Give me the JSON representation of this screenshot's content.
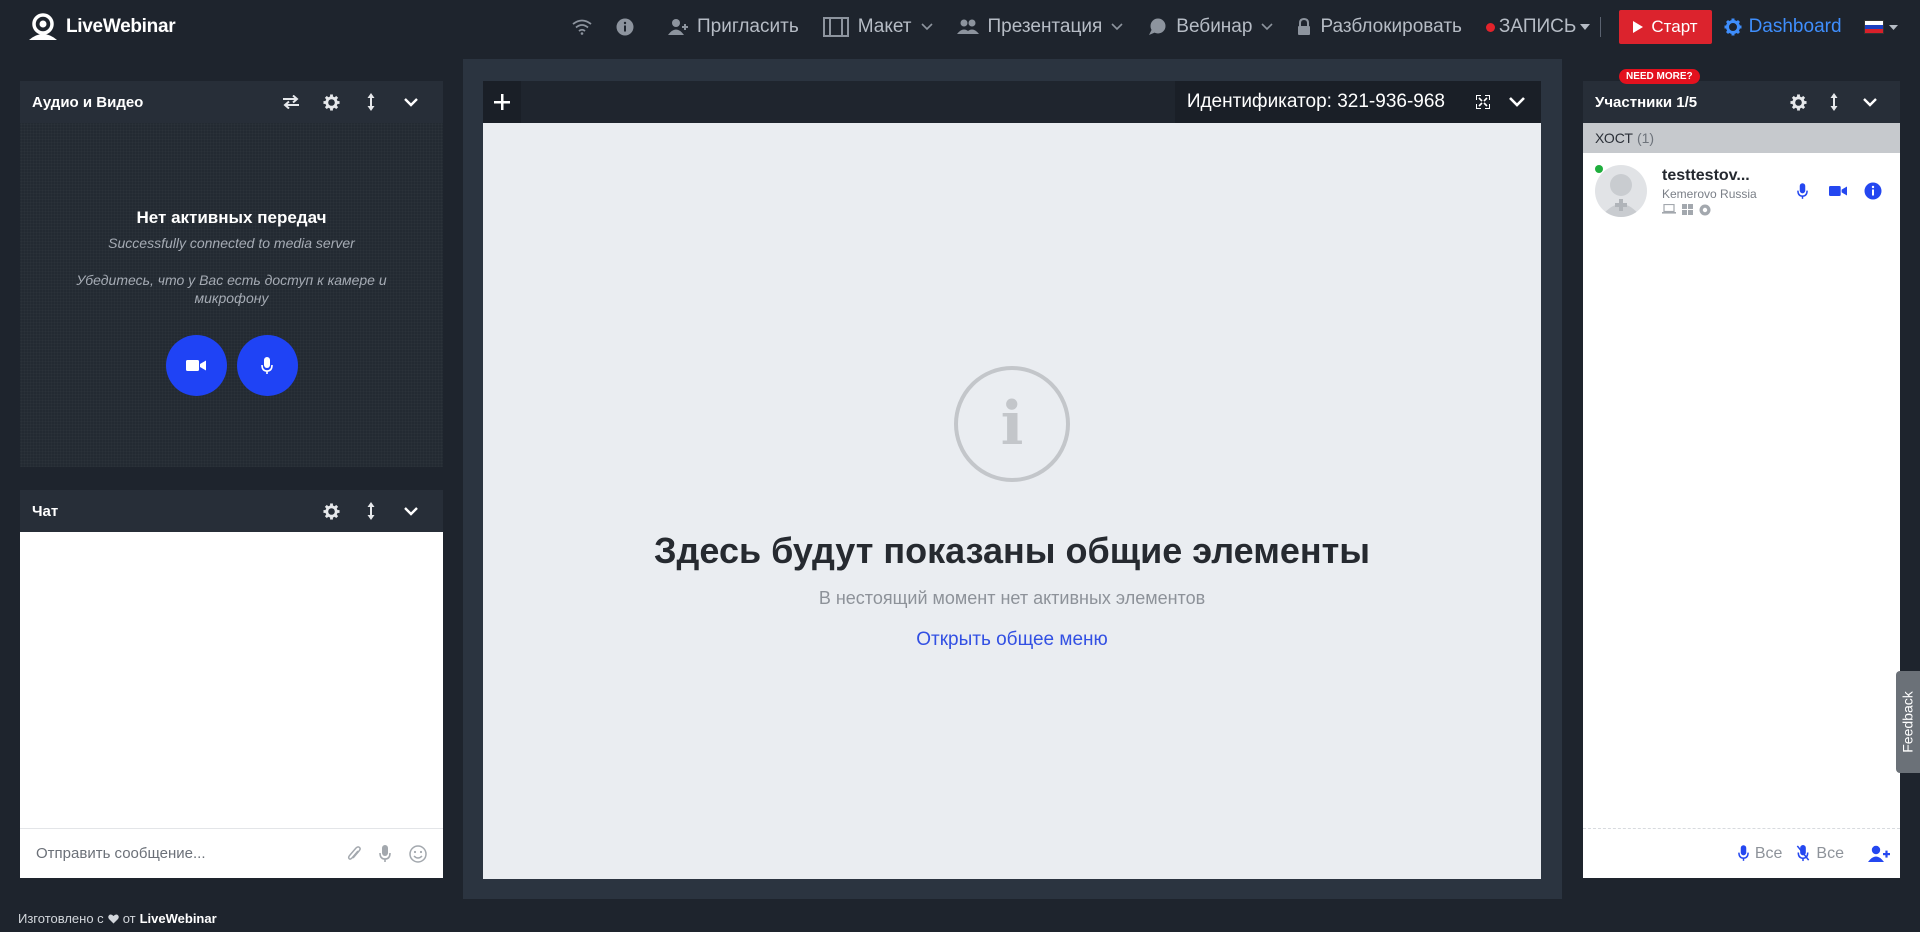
{
  "app": {
    "logo_text": "LiveWebinar"
  },
  "nav": {
    "invite": "Пригласить",
    "layout": "Макет",
    "presentation": "Презентация",
    "webinar": "Вебинар",
    "unlock": "Разблокировать",
    "record": "ЗАПИСЬ",
    "start": "Старт",
    "dashboard": "Dashboard"
  },
  "av_panel": {
    "title": "Аудио и Видео",
    "no_streams": "Нет активных передач",
    "connected": "Successfully connected to media server",
    "hint": "Убедитесь, что у Вас есть доступ к камере и микрофону"
  },
  "chat_panel": {
    "title": "Чат",
    "input_placeholder": "Отправить сообщение..."
  },
  "center": {
    "identifier": "Идентификатор: 321-936-968",
    "empty_title": "Здесь будут показаны общие элементы",
    "empty_sub": "В нестоящий момент нет активных элементов",
    "open_menu_link": "Открыть общее меню"
  },
  "participants": {
    "title": "Участники 1/5",
    "need_more": "NEED MORE?",
    "host_label": "ХОСТ",
    "host_count": "(1)",
    "users": [
      {
        "name": "testtestov...",
        "location": "Kemerovo Russia"
      }
    ],
    "footer_mic_all": "Все",
    "footer_mute_all": "Все"
  },
  "feedback": "Feedback",
  "footer": {
    "made_with": "Изготовлено с",
    "by": "от",
    "brand": "LiveWebinar"
  },
  "colors": {
    "accent_blue": "#1f43f5",
    "start_red": "#dc232d",
    "link_blue": "#3f8efc"
  }
}
